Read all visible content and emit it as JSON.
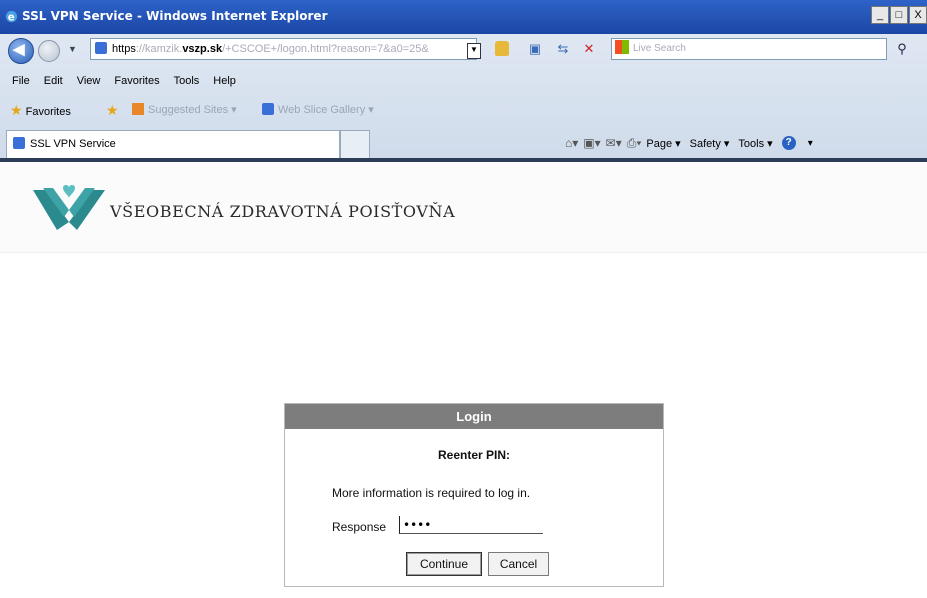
{
  "window": {
    "title": "SSL VPN Service - Windows Internet Explorer",
    "buttons": {
      "minimize": "_",
      "maximize": "□",
      "close": "X"
    }
  },
  "address_bar": {
    "scheme": "https",
    "host_prefix": "://kamzik.",
    "host_bold": "vszp.sk",
    "path_rest": "/+CSCOE+/logon.html?reason=7&a0=25&"
  },
  "search": {
    "placeholder": "Live Search"
  },
  "menu": [
    "File",
    "Edit",
    "View",
    "Favorites",
    "Tools",
    "Help"
  ],
  "favorites_bar": {
    "favorites_label": "Favorites",
    "suggested_sites": "Suggested Sites ▾",
    "web_slice_gallery": "Web Slice Gallery ▾"
  },
  "tab": {
    "title": "SSL VPN Service"
  },
  "command_bar": {
    "page": "Page ▾",
    "safety": "Safety ▾",
    "tools": "Tools ▾"
  },
  "site": {
    "company_name": "VŠEOBECNÁ ZDRAVOTNÁ POISŤOVŇA",
    "brand_color": "#2b8a8e"
  },
  "login": {
    "title": "Login",
    "prompt": "Reenter PIN:",
    "info": "More information is required to log in.",
    "response_label": "Response",
    "response_value": "••••",
    "continue_label": "Continue",
    "cancel_label": "Cancel"
  }
}
